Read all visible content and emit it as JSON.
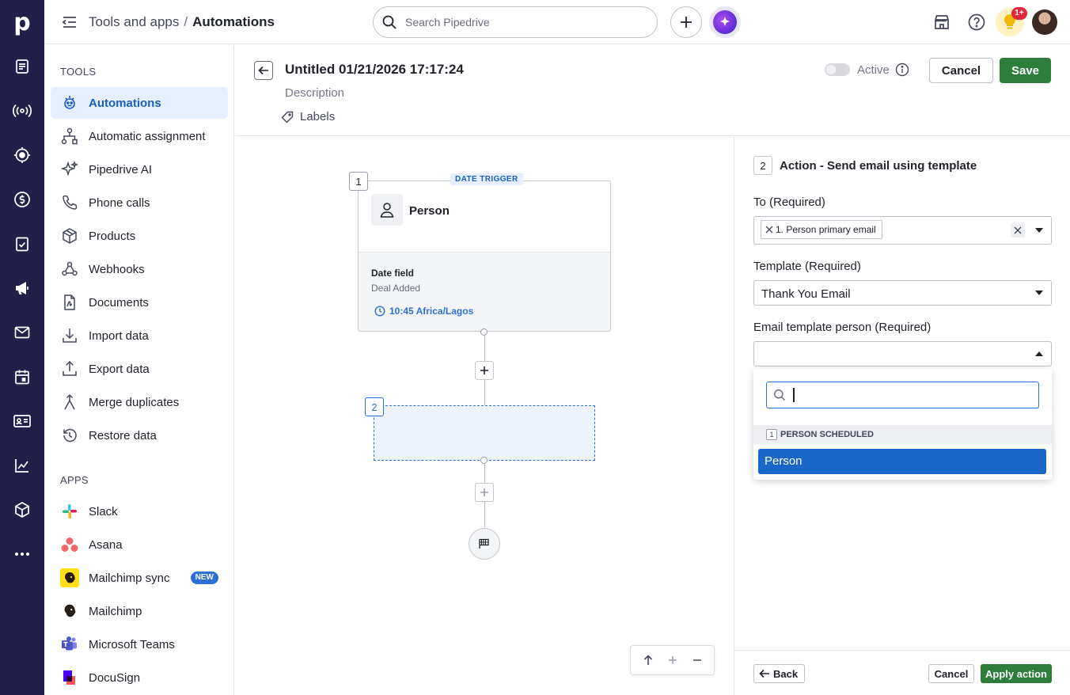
{
  "rail": {
    "logo": "p",
    "items": [
      {
        "icon": "leads-icon"
      },
      {
        "icon": "broadcast-icon"
      },
      {
        "icon": "target-icon"
      },
      {
        "icon": "dollar-icon"
      },
      {
        "icon": "tasks-icon"
      },
      {
        "icon": "megaphone-icon"
      },
      {
        "icon": "mail-icon"
      },
      {
        "icon": "calendar-icon"
      },
      {
        "icon": "contacts-icon"
      },
      {
        "icon": "chart-icon"
      },
      {
        "icon": "box-icon"
      },
      {
        "icon": "more-icon"
      }
    ]
  },
  "topbar": {
    "breadcrumb_parent": "Tools and apps",
    "breadcrumb_sep": "/",
    "breadcrumb_current": "Automations",
    "search_placeholder": "Search Pipedrive",
    "notification_badge": "1+"
  },
  "sidebar": {
    "tools_title": "TOOLS",
    "apps_title": "APPS",
    "tools": [
      {
        "label": "Automations",
        "icon": "automations-icon",
        "active": true
      },
      {
        "label": "Automatic assignment",
        "icon": "assignment-icon"
      },
      {
        "label": "Pipedrive AI",
        "icon": "sparkle-icon"
      },
      {
        "label": "Phone calls",
        "icon": "phone-icon"
      },
      {
        "label": "Products",
        "icon": "product-box-icon"
      },
      {
        "label": "Webhooks",
        "icon": "webhook-icon"
      },
      {
        "label": "Documents",
        "icon": "document-icon"
      },
      {
        "label": "Import data",
        "icon": "import-icon"
      },
      {
        "label": "Export data",
        "icon": "export-icon"
      },
      {
        "label": "Merge duplicates",
        "icon": "merge-icon"
      },
      {
        "label": "Restore data",
        "icon": "restore-icon"
      }
    ],
    "apps": [
      {
        "label": "Slack",
        "icon": "slack-icon"
      },
      {
        "label": "Asana",
        "icon": "asana-icon"
      },
      {
        "label": "Mailchimp sync",
        "icon": "mailchimp-icon",
        "badge": "NEW"
      },
      {
        "label": "Mailchimp",
        "icon": "mailchimp-icon"
      },
      {
        "label": "Microsoft Teams",
        "icon": "teams-icon"
      },
      {
        "label": "DocuSign",
        "icon": "docusign-icon"
      }
    ]
  },
  "editor": {
    "title": "Untitled 01/21/2026 17:17:24",
    "description_placeholder": "Description",
    "labels": "Labels",
    "active_label": "Active",
    "cancel": "Cancel",
    "save": "Save"
  },
  "canvas": {
    "trigger": {
      "number": "1",
      "type": "DATE TRIGGER",
      "object": "Person",
      "field_title": "Date field",
      "field_value": "Deal Added",
      "time": "10:45 Africa/Lagos"
    },
    "placeholder_number": "2"
  },
  "panel": {
    "step_number": "2",
    "title": "Action - Send email using template",
    "to_label": "To (Required)",
    "to_chip": "1. Person primary email",
    "template_label": "Template (Required)",
    "template_value": "Thank You Email",
    "person_label": "Email template person (Required)",
    "dropdown": {
      "group_number": "1",
      "group_label": "PERSON SCHEDULED",
      "option": "Person"
    },
    "back": "Back",
    "cancel": "Cancel",
    "apply": "Apply action"
  },
  "colors": {
    "rail_bg": "#221f4a",
    "primary_green": "#2e7d3a",
    "accent_blue": "#2d6fd6",
    "selected_option": "#1a67c9"
  }
}
